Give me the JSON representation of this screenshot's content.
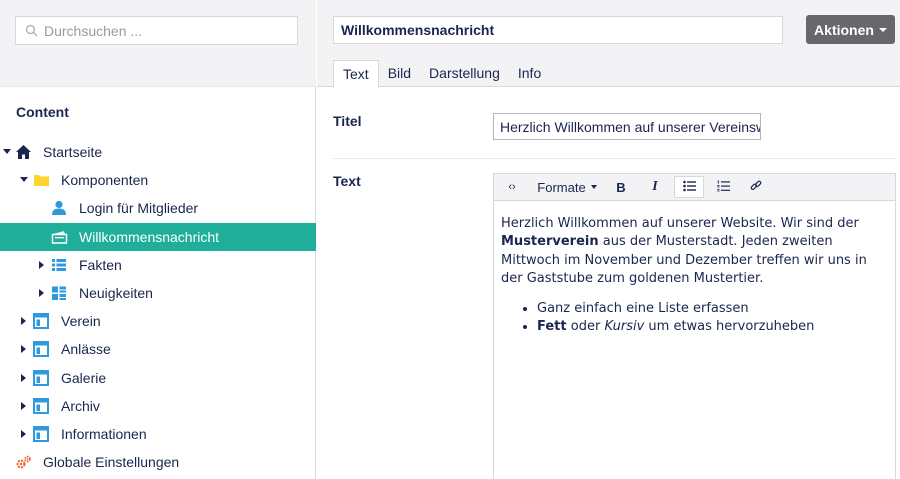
{
  "search": {
    "placeholder": "Durchsuchen ..."
  },
  "sidebar": {
    "heading": "Content",
    "tree": [
      {
        "label": "Startseite"
      },
      {
        "label": "Komponenten"
      },
      {
        "label": "Login für Mitglieder"
      },
      {
        "label": "Willkommensnachricht"
      },
      {
        "label": "Fakten"
      },
      {
        "label": "Neuigkeiten"
      },
      {
        "label": "Verein"
      },
      {
        "label": "Anlässe"
      },
      {
        "label": "Galerie"
      },
      {
        "label": "Archiv"
      },
      {
        "label": "Informationen"
      },
      {
        "label": "Globale Einstellungen"
      }
    ]
  },
  "header": {
    "name_value": "Willkommensnachricht",
    "actions_label": "Aktionen"
  },
  "tabs": [
    {
      "label": "Text"
    },
    {
      "label": "Bild"
    },
    {
      "label": "Darstellung"
    },
    {
      "label": "Info"
    }
  ],
  "form": {
    "titel_label": "Titel",
    "titel_value": "Herzlich Willkommen auf unserer Vereinswebsite",
    "text_label": "Text"
  },
  "editor": {
    "toolbar": {
      "source": "‹›",
      "formats": "Formate",
      "bold": "B",
      "italic": "I"
    },
    "p1": "Herzlich Willkommen auf unserer Website. Wir sind der ",
    "p1_bold": "Musterverein",
    "p1_rest": " aus der Musterstadt. Jeden zweiten Mittwoch im November und Dezember treffen wir uns in der Gaststube zum goldenen Mustertier.",
    "li1": "Ganz einfach eine Liste erfassen",
    "li2_bold": "Fett",
    "li2_mid": " oder ",
    "li2_italic": "Kursiv",
    "li2_rest": " um etwas hervorzuheben"
  },
  "colors": {
    "accent": "#1fae9a",
    "text": "#1b264f",
    "icon_blue": "#2f99de",
    "folder": "#ffd42a",
    "gear": "#e8622b",
    "actions_bg": "#68676d"
  }
}
